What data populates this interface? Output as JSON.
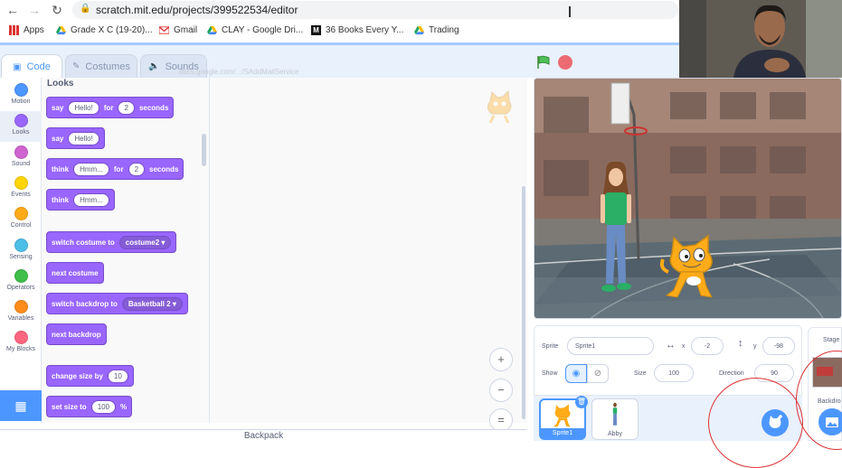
{
  "browser": {
    "url": "scratch.mit.edu/projects/399522534/editor",
    "bookmarks": [
      {
        "label": "Apps",
        "icon": "apps-grid-icon"
      },
      {
        "label": "Grade X C (19-20)...",
        "icon": "google-drive-icon"
      },
      {
        "label": "Gmail",
        "icon": "gmail-icon"
      },
      {
        "label": "CLAY - Google Dri...",
        "icon": "google-drive-icon"
      },
      {
        "label": "36 Books Every Y...",
        "icon": "medium-icon"
      },
      {
        "label": "Trading",
        "icon": "google-drive-icon"
      }
    ]
  },
  "tabs": [
    {
      "label": "Code",
      "icon": "code-icon",
      "active": true
    },
    {
      "label": "Costumes",
      "icon": "brush-icon",
      "active": false
    },
    {
      "label": "Sounds",
      "icon": "speaker-icon",
      "active": false
    }
  ],
  "ghost_url": "docs.google.com/.../SAddMailService",
  "categories": [
    {
      "label": "Motion",
      "color": "#4c97ff"
    },
    {
      "label": "Looks",
      "color": "#9966ff",
      "selected": true
    },
    {
      "label": "Sound",
      "color": "#cf63cf"
    },
    {
      "label": "Events",
      "color": "#ffd500"
    },
    {
      "label": "Control",
      "color": "#ffab19"
    },
    {
      "label": "Sensing",
      "color": "#4cbfe6"
    },
    {
      "label": "Operators",
      "color": "#40bf4a"
    },
    {
      "label": "Variables",
      "color": "#ff8c1a"
    },
    {
      "label": "My Blocks",
      "color": "#ff6680"
    }
  ],
  "palette": {
    "heading": "Looks",
    "blocks": [
      {
        "parts": [
          "say",
          "[Hello!]",
          "for",
          "[2]",
          "seconds"
        ]
      },
      {
        "parts": [
          "say",
          "[Hello!]"
        ]
      },
      {
        "parts": [
          "think",
          "[Hmm...]",
          "for",
          "[2]",
          "seconds"
        ]
      },
      {
        "parts": [
          "think",
          "[Hmm...]"
        ]
      },
      {
        "parts": [
          "switch costume to",
          "{costume2}"
        ]
      },
      {
        "parts": [
          "next costume"
        ]
      },
      {
        "parts": [
          "switch backdrop to",
          "{Basketball 2}"
        ]
      },
      {
        "parts": [
          "next backdrop"
        ]
      },
      {
        "parts": [
          "change size by",
          "[10]"
        ]
      },
      {
        "parts": [
          "set size to",
          "[100]",
          "%"
        ]
      }
    ]
  },
  "zoom_buttons": [
    {
      "label": "+",
      "name": "zoom-in-button"
    },
    {
      "label": "−",
      "name": "zoom-out-button"
    },
    {
      "label": "=",
      "name": "zoom-reset-button"
    }
  ],
  "backpack_label": "Backpack",
  "sprite_info": {
    "sprite_label": "Sprite",
    "sprite_name": "Sprite1",
    "x_label": "x",
    "x_value": "-2",
    "y_label": "y",
    "y_value": "-98",
    "show_label": "Show",
    "size_label": "Size",
    "size_value": "100",
    "direction_label": "Direction",
    "direction_value": "90"
  },
  "sprites": [
    {
      "name": "Sprite1",
      "selected": true
    },
    {
      "name": "Abby",
      "selected": false
    }
  ],
  "stage_pane": {
    "label": "Stage",
    "backdrops_label": "Backdro"
  },
  "colors": {
    "accent": "#4c97ff",
    "looks": "#9966ff",
    "annotation_ring": "#dd3333"
  }
}
